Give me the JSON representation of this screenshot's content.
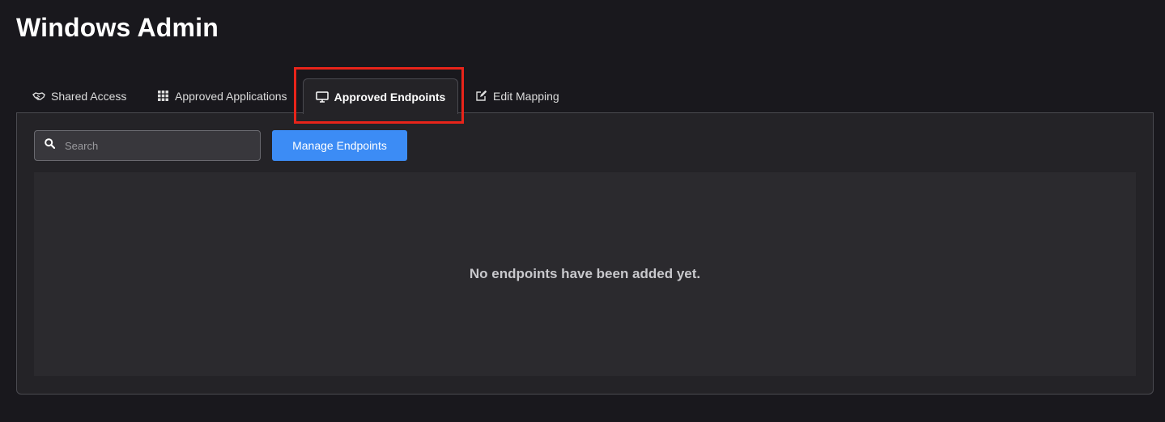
{
  "page": {
    "title": "Windows Admin"
  },
  "tabs": [
    {
      "label": "Shared Access",
      "icon": "handshake-icon"
    },
    {
      "label": "Approved Applications",
      "icon": "grid-icon"
    },
    {
      "label": "Approved Endpoints",
      "icon": "monitor-icon",
      "active": true
    },
    {
      "label": "Edit Mapping",
      "icon": "edit-icon"
    }
  ],
  "toolbar": {
    "search_placeholder": "Search",
    "search_value": "",
    "manage_label": "Manage Endpoints"
  },
  "content": {
    "empty_message": "No endpoints have been added yet."
  },
  "colors": {
    "accent": "#3c8cf5",
    "highlight": "#e8241a",
    "background": "#19181d"
  }
}
